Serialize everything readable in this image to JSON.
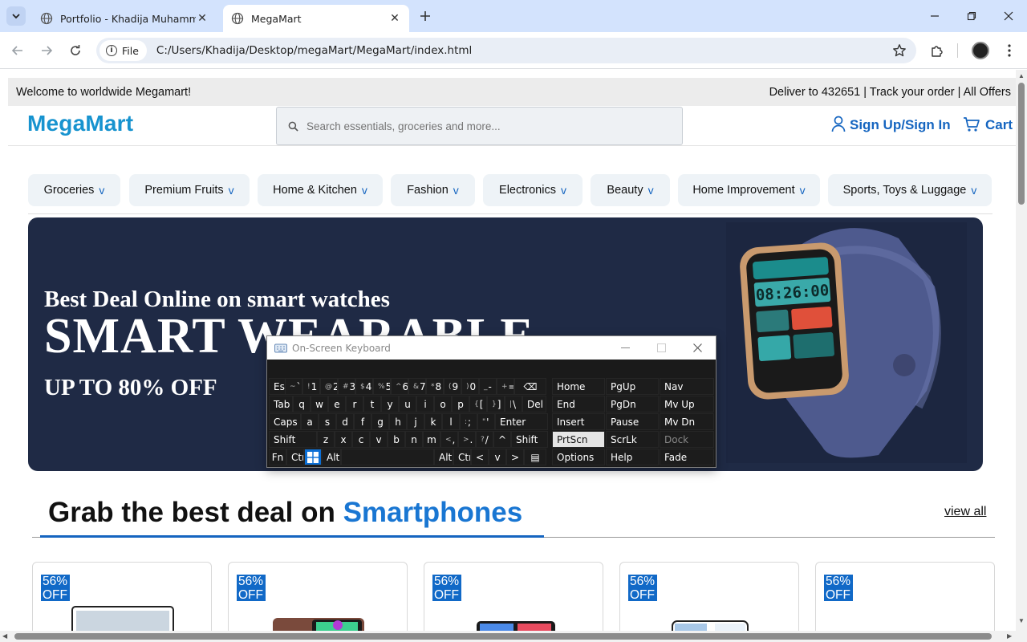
{
  "browser": {
    "tabs": [
      {
        "title": "Portfolio - Khadija Muhammad",
        "active": false
      },
      {
        "title": "MegaMart",
        "active": true
      }
    ],
    "file_chip": "File",
    "url": "C:/Users/Khadija/Desktop/megaMart/MegaMart/index.html"
  },
  "site": {
    "topbar": {
      "welcome": "Welcome to worldwide Megamart!",
      "links": "Deliver to 432651 | Track your order | All Offers"
    },
    "logo": "MegaMart",
    "search_placeholder": "Search essentials, groceries and more...",
    "signin_label": "Sign Up/Sign In",
    "cart_label": "Cart",
    "categories": [
      {
        "label": "Groceries",
        "chevron": "v"
      },
      {
        "label": "Premium Fruits",
        "chevron": "v"
      },
      {
        "label": "Home & Kitchen",
        "chevron": "v"
      },
      {
        "label": "Fashion",
        "chevron": "v"
      },
      {
        "label": "Electronics",
        "chevron": "v"
      },
      {
        "label": "Beauty",
        "chevron": "v"
      },
      {
        "label": "Home Improvement",
        "chevron": "v"
      },
      {
        "label": "Sports, Toys & Luggage",
        "chevron": "v"
      }
    ],
    "banner": {
      "subtitle": "Best Deal Online on smart watches",
      "title": "SMART WEARABLE",
      "offer": "UP TO 80% OFF",
      "watch_time": "08:26:00"
    },
    "deals": {
      "heading_prefix": "Grab the best deal on ",
      "heading_highlight": "Smartphones",
      "view_all": "view all",
      "badges": [
        "56% OFF",
        "56% OFF",
        "56% OFF",
        "56% OFF",
        "56% OFF"
      ]
    }
  },
  "osk": {
    "title": "On-Screen Keyboard",
    "rows": [
      [
        "Esc",
        "~ `",
        "! 1",
        "@ 2",
        "# 3",
        "$ 4",
        "% 5",
        "^ 6",
        "& 7",
        "* 8",
        "( 9",
        ") 0",
        "_ -",
        "+ =",
        "⌫"
      ],
      [
        "Tab",
        "q",
        "w",
        "e",
        "r",
        "t",
        "y",
        "u",
        "i",
        "o",
        "p",
        "{ [",
        "} ]",
        "| \\",
        "Del"
      ],
      [
        "Caps",
        "a",
        "s",
        "d",
        "f",
        "g",
        "h",
        "j",
        "k",
        "l",
        ": ;",
        "\" '",
        "Enter"
      ],
      [
        "Shift",
        "z",
        "x",
        "c",
        "v",
        "b",
        "n",
        "m",
        "< ,",
        "> .",
        "? /",
        "^",
        "Shift"
      ],
      [
        "Fn",
        "Ctrl",
        "⊞",
        "Alt",
        "",
        "Alt",
        "Ctrl",
        "<",
        "v",
        ">",
        "▤"
      ]
    ],
    "nav_keys": [
      [
        "Home",
        "PgUp",
        "Nav"
      ],
      [
        "End",
        "PgDn",
        "Mv Up"
      ],
      [
        "Insert",
        "Pause",
        "Mv Dn"
      ],
      [
        "PrtScn",
        "ScrLk",
        "Dock"
      ],
      [
        "Options",
        "Help",
        "Fade"
      ]
    ]
  }
}
